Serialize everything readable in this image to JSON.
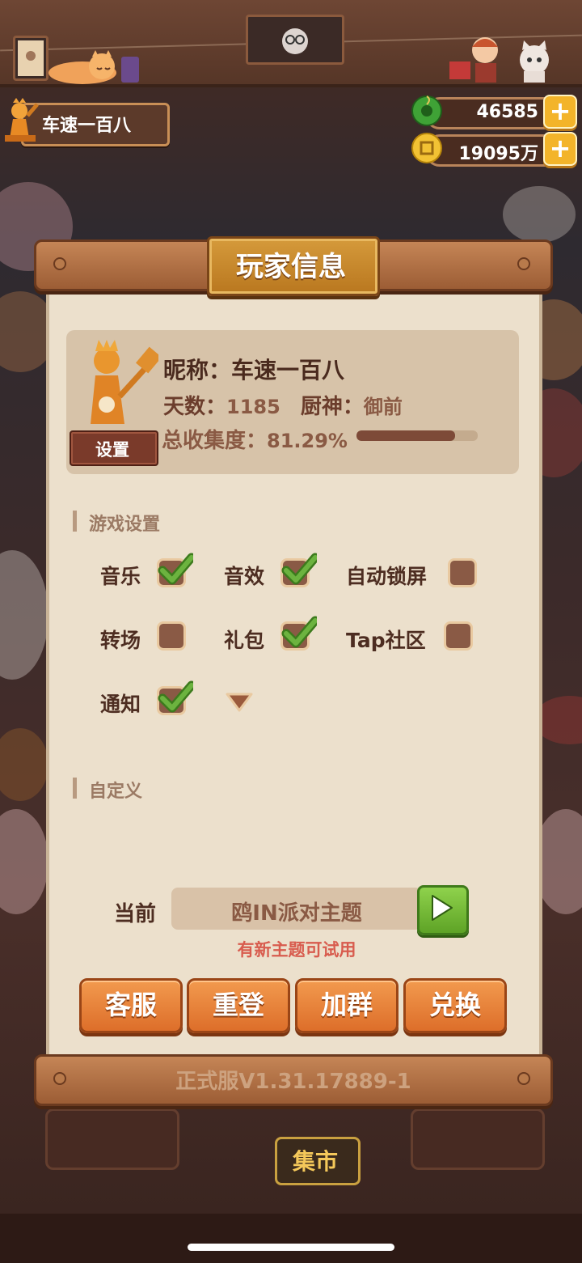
{
  "hud": {
    "player_name": "车速一百八",
    "jade_amount": "46585",
    "coin_amount": "19095万",
    "plus_symbol": "+"
  },
  "dialog": {
    "title": "玩家信息",
    "settings_button": "设置",
    "nickname_label": "昵称：",
    "nickname_value": "车速一百八",
    "days_label": "天数：",
    "days_value": "1185",
    "chef_label": "厨神：",
    "chef_value": "御前",
    "collection_label": "总收集度：",
    "collection_value": "81.29%",
    "collection_progress": 0.8129
  },
  "game_settings": {
    "section_title": "游戏设置",
    "options": [
      {
        "label": "音乐",
        "checked": true
      },
      {
        "label": "音效",
        "checked": true
      },
      {
        "label": "自动锁屏",
        "checked": false
      },
      {
        "label": "转场",
        "checked": false
      },
      {
        "label": "礼包",
        "checked": true
      },
      {
        "label": "Tap社区",
        "checked": false
      },
      {
        "label": "通知",
        "checked": true
      }
    ]
  },
  "custom": {
    "section_title": "自定义",
    "current_label": "当前",
    "theme_name": "鸥IN派对主题",
    "theme_hint": "有新主题可试用"
  },
  "actions": {
    "support": "客服",
    "relogin": "重登",
    "join_group": "加群",
    "redeem": "兑换"
  },
  "version": "正式服V1.31.17889-1",
  "market_sign": "集市",
  "colors": {
    "accent_orange": "#dd6e2a",
    "check_green": "#6cb33f",
    "paper": "#ece0cc",
    "hint_red": "#d85c4e"
  }
}
